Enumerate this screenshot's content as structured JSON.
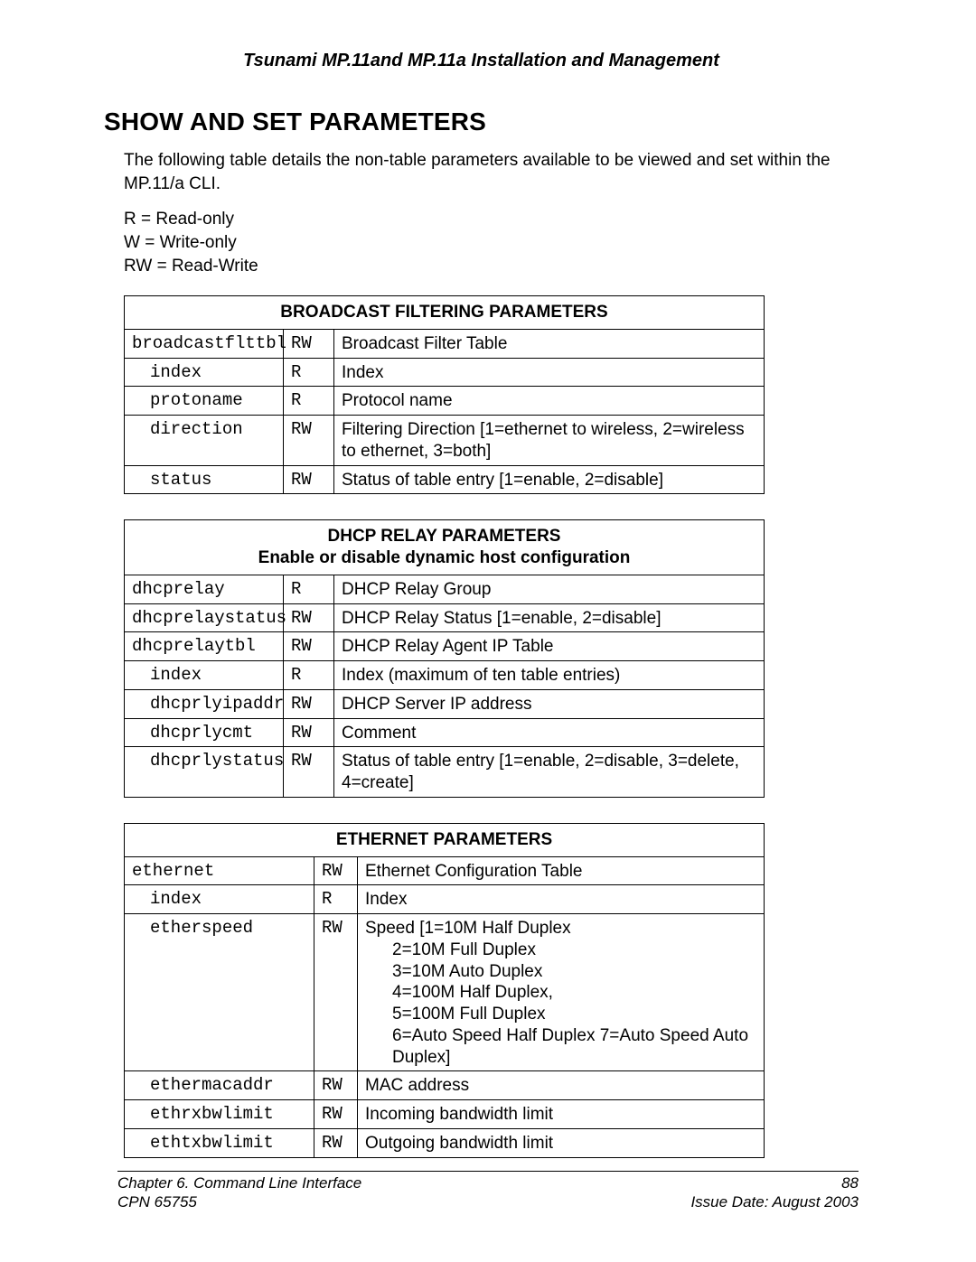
{
  "header": "Tsunami MP.11and MP.11a Installation and Management",
  "section_title": "SHOW AND SET PARAMETERS",
  "intro": "The following table details the non-table parameters available to be viewed and set within the MP.11/a CLI.",
  "legend": {
    "r": "R = Read-only",
    "w": "W = Write-only",
    "rw": "RW = Read-Write"
  },
  "tables": [
    {
      "title": "BROADCAST FILTERING PARAMETERS",
      "subtitle": "",
      "col_widths": "narrow",
      "rows": [
        {
          "name": "broadcastflttbl",
          "indent": 0,
          "rw": "RW",
          "desc": "Broadcast Filter Table"
        },
        {
          "name": "index",
          "indent": 1,
          "rw": "R",
          "desc": "Index"
        },
        {
          "name": "protoname",
          "indent": 1,
          "rw": "R",
          "desc": "Protocol name"
        },
        {
          "name": "direction",
          "indent": 1,
          "rw": "RW",
          "desc": "Filtering Direction [1=ethernet to wireless, 2=wireless to ethernet, 3=both]"
        },
        {
          "name": "status",
          "indent": 1,
          "rw": "RW",
          "desc": "Status of table entry [1=enable, 2=disable]"
        }
      ]
    },
    {
      "title": "DHCP RELAY PARAMETERS",
      "subtitle": "Enable or disable dynamic host configuration",
      "col_widths": "narrow",
      "rows": [
        {
          "name": "dhcprelay",
          "indent": 0,
          "rw": "R",
          "desc": "DHCP Relay Group"
        },
        {
          "name": "dhcprelaystatus",
          "indent": 0,
          "rw": "RW",
          "desc": "DHCP Relay Status [1=enable, 2=disable]"
        },
        {
          "name": "dhcprelaytbl",
          "indent": 0,
          "rw": "RW",
          "desc": "DHCP Relay Agent IP Table"
        },
        {
          "name": "index",
          "indent": 1,
          "rw": "R",
          "desc": "Index (maximum of ten table entries)"
        },
        {
          "name": "dhcprlyipaddr",
          "indent": 1,
          "rw": "RW",
          "desc": "DHCP Server IP address"
        },
        {
          "name": "dhcprlycmt",
          "indent": 1,
          "rw": "RW",
          "desc": "Comment"
        },
        {
          "name": "dhcprlystatus",
          "indent": 1,
          "rw": "RW",
          "desc": "Status of table entry [1=enable, 2=disable, 3=delete, 4=create]"
        }
      ]
    },
    {
      "title": "ETHERNET PARAMETERS",
      "subtitle": "",
      "col_widths": "wide",
      "rows": [
        {
          "name": "ethernet",
          "indent": 0,
          "rw": "RW",
          "desc": "Ethernet Configuration Table"
        },
        {
          "name": "index",
          "indent": 1,
          "rw": "R",
          "desc": "Index"
        },
        {
          "name": "etherspeed",
          "indent": 1,
          "rw": "RW",
          "desc_lines": [
            "Speed [1=10M Half Duplex",
            "2=10M Full Duplex",
            "3=10M Auto Duplex",
            "4=100M Half Duplex,",
            "5=100M Full Duplex",
            "6=Auto Speed Half Duplex 7=Auto Speed Auto Duplex]"
          ]
        },
        {
          "name": "ethermacaddr",
          "indent": 1,
          "rw": "RW",
          "desc": "MAC address"
        },
        {
          "name": "ethrxbwlimit",
          "indent": 1,
          "rw": "RW",
          "desc": "Incoming bandwidth limit"
        },
        {
          "name": "ethtxbwlimit",
          "indent": 1,
          "rw": "RW",
          "desc": "Outgoing bandwidth limit"
        }
      ]
    }
  ],
  "footer": {
    "left_top": "Chapter 6.  Command Line Interface",
    "right_top": "88",
    "left_bottom": "CPN 65755",
    "right_bottom": "Issue Date:  August 2003"
  }
}
